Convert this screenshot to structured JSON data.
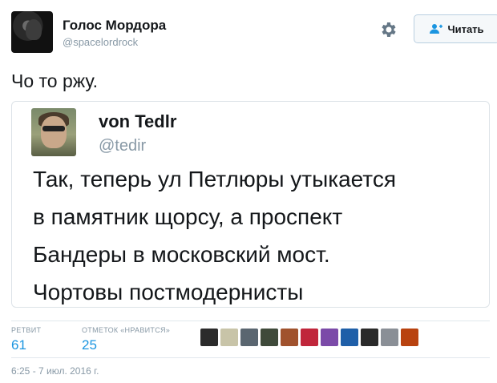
{
  "author": {
    "name": "Голос Мордора",
    "handle": "@spacelordrock"
  },
  "follow_button": {
    "label": "Читать"
  },
  "tweet": {
    "text": "Чо то ржу."
  },
  "quoted": {
    "name": "von Tedlr",
    "handle": "@tedir",
    "lines": [
      "Так, теперь ул Петлюры утыкается",
      "в памятник щорсу, а проспект",
      "Бандеры в московский мост.",
      "Чортовы постмодернисты"
    ]
  },
  "stats": {
    "retweets_label": "РЕТВИТ",
    "retweets": "61",
    "likes_label": "ОТМЕТОК «НРАВИТСЯ»",
    "likes": "25"
  },
  "likers": [
    {
      "name": "liker-1",
      "color": "#2b2b2b"
    },
    {
      "name": "liker-2",
      "color": "#c8c4a8"
    },
    {
      "name": "liker-3",
      "color": "#5a6670"
    },
    {
      "name": "liker-4",
      "color": "#3f4a3a"
    },
    {
      "name": "liker-5",
      "color": "#a0522d"
    },
    {
      "name": "liker-6",
      "color": "#c0263b"
    },
    {
      "name": "liker-7",
      "color": "#7b4aa8"
    },
    {
      "name": "liker-8",
      "color": "#1f5fa8"
    },
    {
      "name": "liker-9",
      "color": "#2a2a2a"
    },
    {
      "name": "liker-10",
      "color": "#8a8f96"
    },
    {
      "name": "liker-11",
      "color": "#b8420f"
    }
  ],
  "timestamp": "6:25 - 7 июл. 2016 г."
}
